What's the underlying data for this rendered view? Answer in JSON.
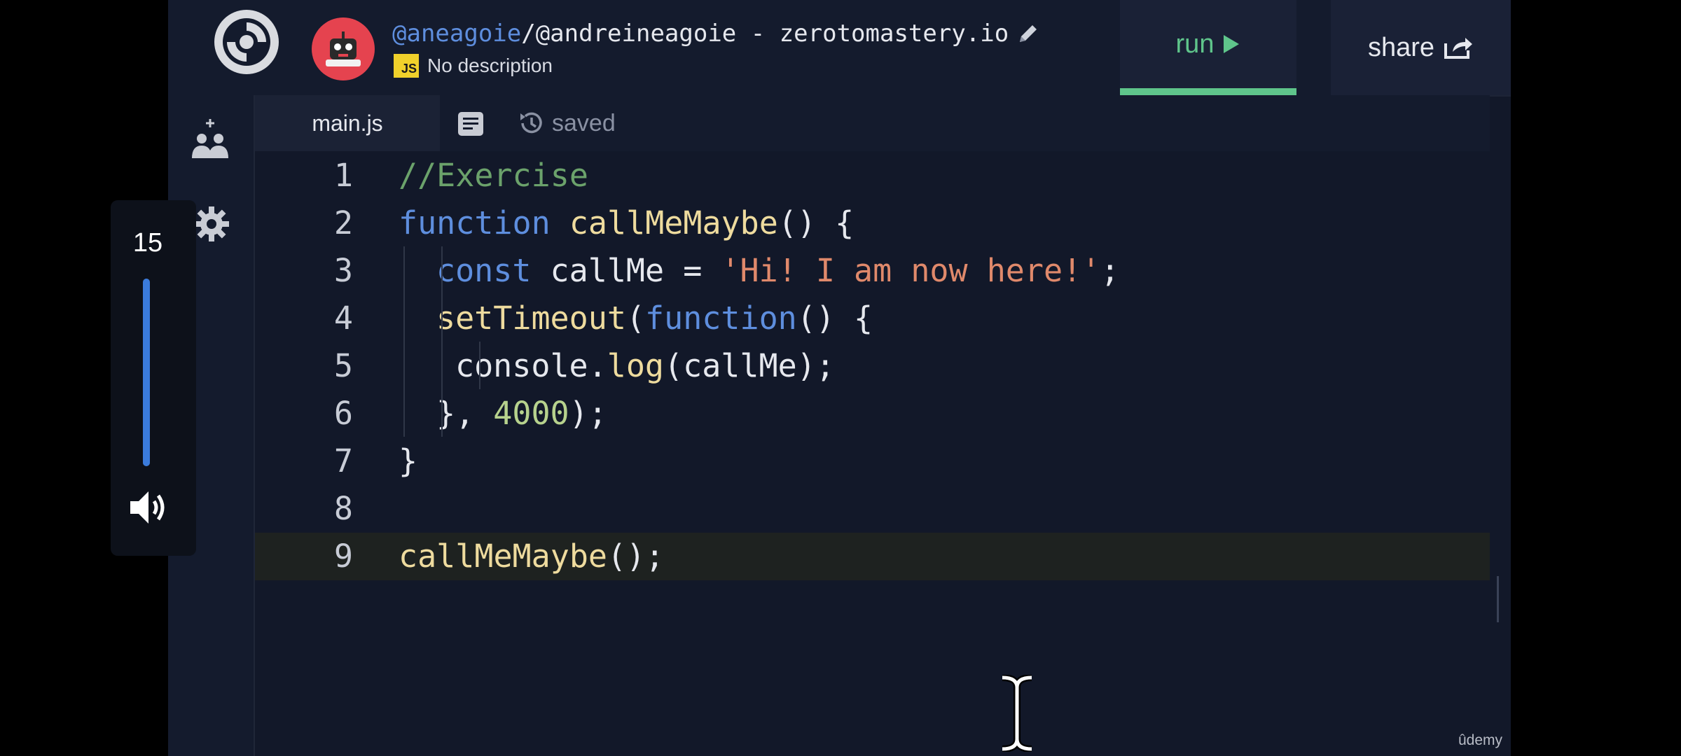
{
  "header": {
    "owner_user": "@aneagoie",
    "owner_rest": "/@andreineagoie - zerotomastery.io",
    "language_badge": "JS",
    "description": "No description",
    "run_label": "run",
    "share_label": "share"
  },
  "tabs": {
    "main_file": "main.js",
    "status": "saved"
  },
  "editor": {
    "lines": [
      {
        "n": "1",
        "tokens": [
          {
            "t": "//Exercise",
            "c": "cm"
          }
        ]
      },
      {
        "n": "2",
        "tokens": [
          {
            "t": "function",
            "c": "kw"
          },
          {
            "t": " ",
            "c": "plain"
          },
          {
            "t": "callMeMaybe",
            "c": "fn"
          },
          {
            "t": "() {",
            "c": "plain"
          }
        ]
      },
      {
        "n": "3",
        "tokens": [
          {
            "t": "const",
            "c": "kw"
          },
          {
            "t": " callMe = ",
            "c": "plain"
          },
          {
            "t": "'Hi! I am now here!'",
            "c": "str"
          },
          {
            "t": ";",
            "c": "plain"
          }
        ]
      },
      {
        "n": "4",
        "tokens": [
          {
            "t": "setTimeout",
            "c": "fn"
          },
          {
            "t": "(",
            "c": "plain"
          },
          {
            "t": "function",
            "c": "kw"
          },
          {
            "t": "() {",
            "c": "plain"
          }
        ]
      },
      {
        "n": "5",
        "tokens": [
          {
            "t": "console.",
            "c": "plain"
          },
          {
            "t": "log",
            "c": "fn"
          },
          {
            "t": "(callMe);",
            "c": "plain"
          }
        ]
      },
      {
        "n": "6",
        "tokens": [
          {
            "t": "}, ",
            "c": "plain"
          },
          {
            "t": "4000",
            "c": "num"
          },
          {
            "t": ");",
            "c": "plain"
          }
        ]
      },
      {
        "n": "7",
        "tokens": [
          {
            "t": "}",
            "c": "plain"
          }
        ]
      },
      {
        "n": "8",
        "tokens": []
      },
      {
        "n": "9",
        "tokens": [
          {
            "t": "callMeMaybe",
            "c": "fn"
          },
          {
            "t": "();",
            "c": "plain"
          }
        ]
      }
    ],
    "current_line": "9"
  },
  "volume": {
    "value": "15",
    "level": 1.0
  },
  "watermark": "ûdemy",
  "colors": {
    "accent_green": "#5fc58b",
    "keyword_blue": "#5e8ede",
    "volume_blue": "#3a7bdc"
  }
}
